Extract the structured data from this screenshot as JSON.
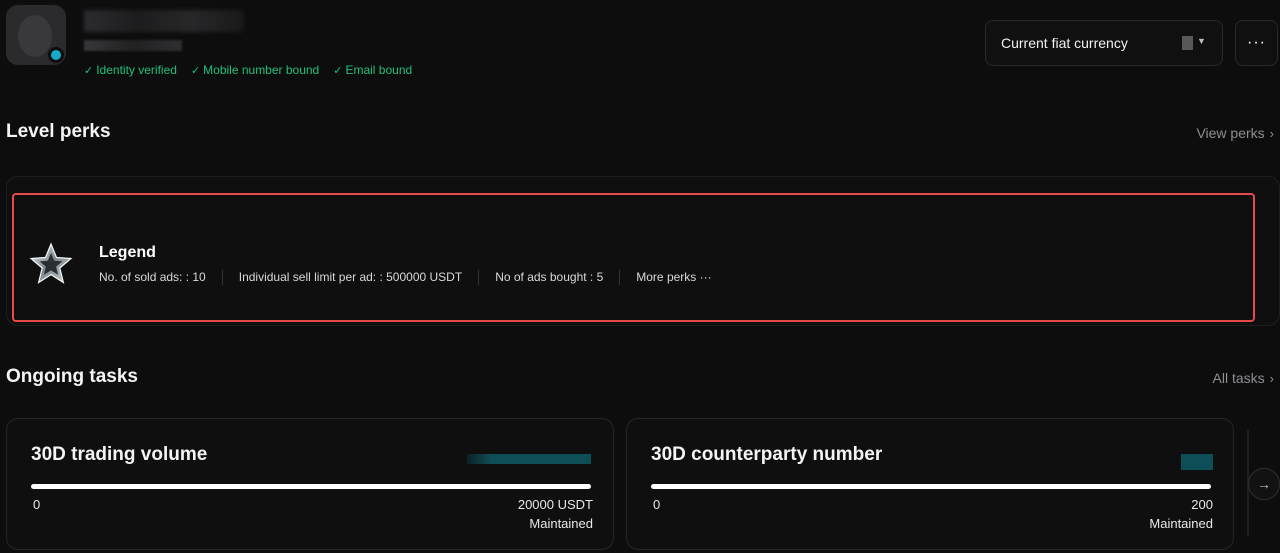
{
  "profile": {
    "verifications": [
      "Identity verified",
      "Mobile number bound",
      "Email bound"
    ]
  },
  "header": {
    "fiat_label": "Current fiat currency",
    "more_label": "···"
  },
  "level_perks": {
    "title": "Level perks",
    "link": "View perks",
    "level_name": "Legend",
    "perks": [
      "No. of sold ads: : 10",
      "Individual sell limit per ad: : 500000 USDT",
      "No of ads bought : 5"
    ],
    "more_perks": "More perks ···"
  },
  "ongoing_tasks": {
    "title": "Ongoing tasks",
    "link": "All tasks",
    "tasks": [
      {
        "title": "30D trading volume",
        "start": "0",
        "target": "20000 USDT",
        "status": "Maintained",
        "progress": 1.0
      },
      {
        "title": "30D counterparty number",
        "start": "0",
        "target": "200",
        "status": "Maintained",
        "progress": 1.0
      }
    ]
  },
  "icons": {
    "verified": "check-icon",
    "chevron": "chevron-right-icon",
    "badge": "star-badge-icon",
    "next": "arrow-right-icon"
  },
  "colors": {
    "background": "#0d0d0e",
    "verified_green": "#1fc07a",
    "online_dot": "#17a9c9",
    "highlight": "#e8494a"
  }
}
